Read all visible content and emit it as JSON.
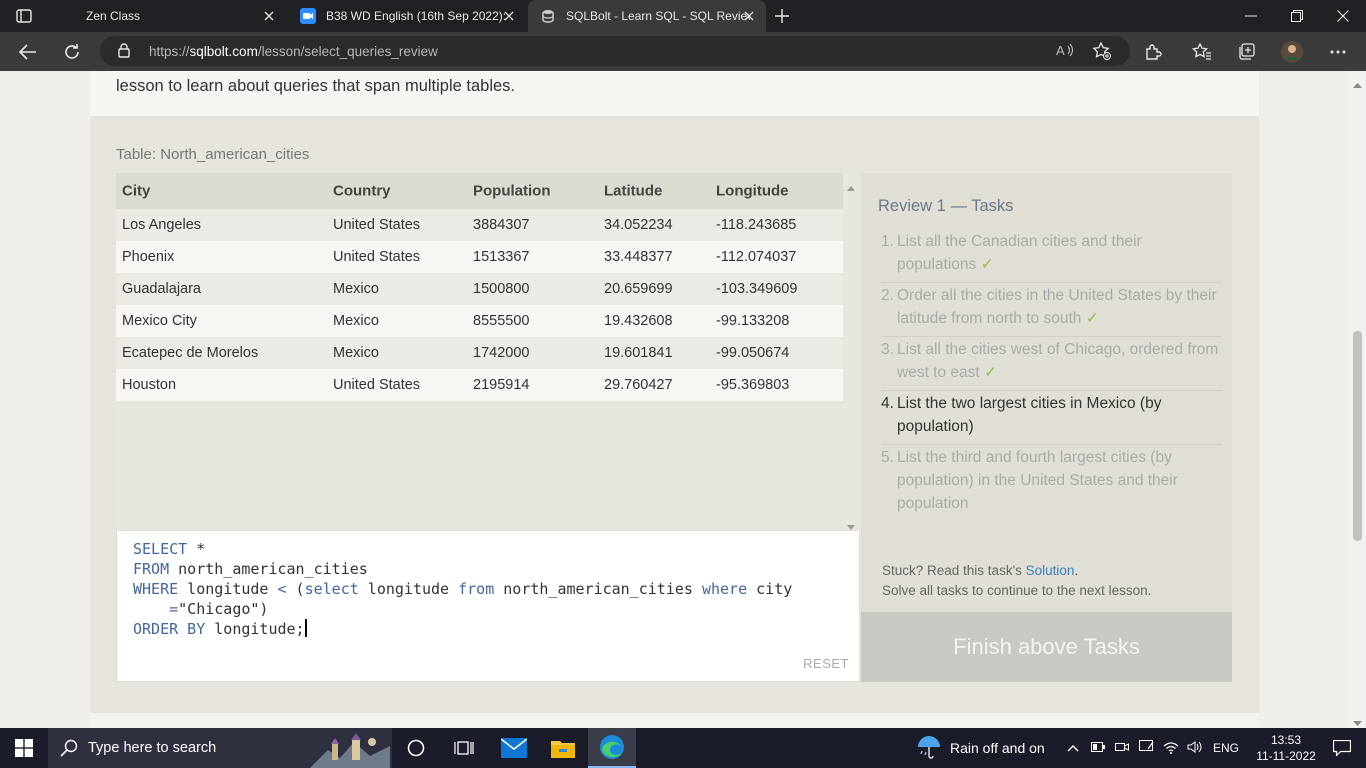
{
  "browser": {
    "tabs": [
      {
        "title": "Zen Class",
        "active": false
      },
      {
        "title": "B38 WD English (16th Sep 2022):",
        "active": false
      },
      {
        "title": "SQLBolt - Learn SQL - SQL Review",
        "active": true
      }
    ],
    "url": {
      "scheme": "https://",
      "host": "sqlbolt.com",
      "path": "/lesson/select_queries_review"
    }
  },
  "page": {
    "lesson_text": "lesson to learn about queries that span multiple tables.",
    "table_caption": "Table: North_american_cities",
    "table": {
      "columns": [
        "City",
        "Country",
        "Population",
        "Latitude",
        "Longitude"
      ],
      "rows": [
        [
          "Los Angeles",
          "United States",
          "3884307",
          "34.052234",
          "-118.243685"
        ],
        [
          "Phoenix",
          "United States",
          "1513367",
          "33.448377",
          "-112.074037"
        ],
        [
          "Guadalajara",
          "Mexico",
          "1500800",
          "20.659699",
          "-103.349609"
        ],
        [
          "Mexico City",
          "Mexico",
          "8555500",
          "19.432608",
          "-99.133208"
        ],
        [
          "Ecatepec de Morelos",
          "Mexico",
          "1742000",
          "19.601841",
          "-99.050674"
        ],
        [
          "Houston",
          "United States",
          "2195914",
          "29.760427",
          "-95.369803"
        ]
      ]
    },
    "editor": {
      "lines": [
        [
          {
            "t": "SELECT",
            "k": true
          },
          {
            "t": " *",
            "k": false
          }
        ],
        [
          {
            "t": "FROM",
            "k": true
          },
          {
            "t": " north_american_cities",
            "k": false
          }
        ],
        [
          {
            "t": "WHERE",
            "k": true
          },
          {
            "t": " longitude ",
            "k": false
          },
          {
            "t": "<",
            "k": true
          },
          {
            "t": " (",
            "k": false
          },
          {
            "t": "select",
            "k": true
          },
          {
            "t": " longitude ",
            "k": false
          },
          {
            "t": "from",
            "k": true
          },
          {
            "t": " north_american_cities ",
            "k": false
          },
          {
            "t": "where",
            "k": true
          },
          {
            "t": " city",
            "k": false
          }
        ],
        [
          {
            "t": "    =",
            "k": true
          },
          {
            "t": "\"Chicago\")",
            "k": false
          }
        ],
        [
          {
            "t": "ORDER BY",
            "k": true
          },
          {
            "t": " longitude;",
            "k": false
          }
        ]
      ],
      "reset_label": "RESET"
    },
    "tasks": {
      "title": "Review 1 — Tasks",
      "items": [
        {
          "num": "1.",
          "text": "List all the Canadian cities and their populations",
          "done": true
        },
        {
          "num": "2.",
          "text": "Order all the cities in the United States by their latitude from north to south",
          "done": true
        },
        {
          "num": "3.",
          "text": "List all the cities west of Chicago, ordered from west to east",
          "done": true
        },
        {
          "num": "4.",
          "text": "List the two largest cities in Mexico (by population)",
          "done": false
        },
        {
          "num": "5.",
          "text": "List the third and fourth largest cities (by population) in the United States and their population",
          "done": false
        }
      ],
      "check_glyph": "✓",
      "stuck_prefix": "Stuck? Read this task's ",
      "solution_link": "Solution",
      "stuck_suffix": ".",
      "solve_all": "Solve all tasks to continue to the next lesson.",
      "finish_button": "Finish above Tasks"
    }
  },
  "taskbar": {
    "search_placeholder": "Type here to search",
    "weather": "Rain off and on",
    "language": "ENG",
    "time": "13:53",
    "date": "11-11-2022"
  }
}
